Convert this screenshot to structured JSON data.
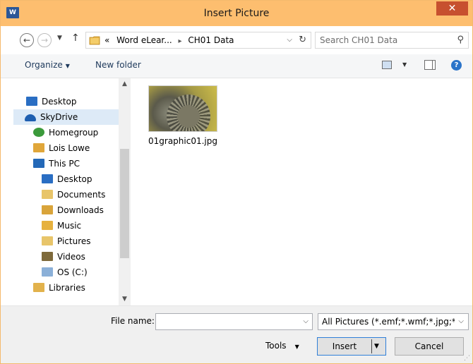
{
  "window": {
    "title": "Insert Picture",
    "app_icon_text": "W",
    "close_glyph": "✕"
  },
  "address": {
    "breadcrumb_prefix": "«",
    "crumbs": [
      "Word eLear...",
      "CH01 Data"
    ],
    "crumb_separator": "▸"
  },
  "search": {
    "placeholder": "Search CH01 Data"
  },
  "toolbar": {
    "organize_label": "Organize",
    "new_folder_label": "New folder"
  },
  "nav": {
    "items": [
      {
        "label": "Desktop",
        "icon": "desktop-icon",
        "selected": false
      },
      {
        "label": "SkyDrive",
        "icon": "skydrive-icon",
        "selected": true
      },
      {
        "label": "Homegroup",
        "icon": "homegroup-icon",
        "selected": false
      },
      {
        "label": "Lois Lowe",
        "icon": "user-folder-icon",
        "selected": false
      },
      {
        "label": "This PC",
        "icon": "computer-icon",
        "selected": false
      },
      {
        "label": "Desktop",
        "icon": "desktop-folder-icon",
        "selected": false
      },
      {
        "label": "Documents",
        "icon": "documents-folder-icon",
        "selected": false
      },
      {
        "label": "Downloads",
        "icon": "downloads-folder-icon",
        "selected": false
      },
      {
        "label": "Music",
        "icon": "music-folder-icon",
        "selected": false
      },
      {
        "label": "Pictures",
        "icon": "pictures-folder-icon",
        "selected": false
      },
      {
        "label": "Videos",
        "icon": "videos-folder-icon",
        "selected": false
      },
      {
        "label": "OS (C:)",
        "icon": "drive-icon",
        "selected": false
      },
      {
        "label": "Libraries",
        "icon": "libraries-icon",
        "selected": false
      }
    ]
  },
  "files": [
    {
      "name": "01graphic01.jpg"
    }
  ],
  "bottom": {
    "file_name_label": "File name:",
    "file_name_value": "",
    "filter_value": "All Pictures (*.emf;*.wmf;*.jpg;*",
    "tools_label": "Tools",
    "insert_label": "Insert",
    "cancel_label": "Cancel"
  },
  "colors": {
    "titlebar": "#fdbe6f",
    "close_button": "#c7502f",
    "selected_nav": "#ddeaf7",
    "primary_button_border": "#2f7fd8"
  }
}
